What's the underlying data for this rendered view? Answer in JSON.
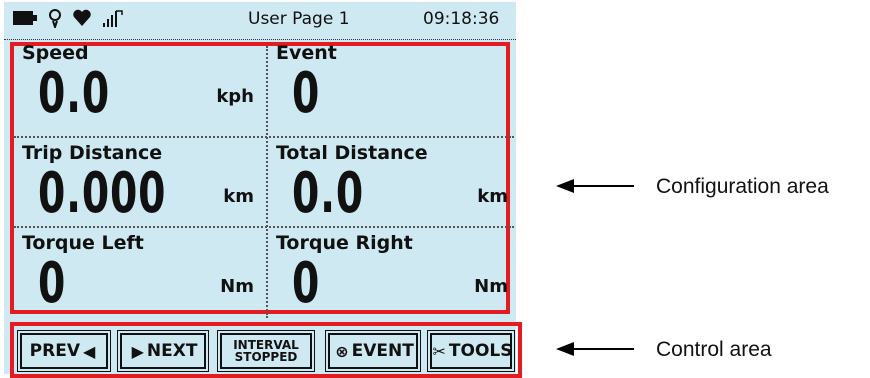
{
  "statusbar": {
    "icons": [
      "battery-icon",
      "location-icon",
      "heart-icon",
      "signal-icon"
    ],
    "title": "User Page 1",
    "time": "09:18:36"
  },
  "fields": [
    {
      "label": "Speed",
      "value": "0.0",
      "unit": "kph"
    },
    {
      "label": "Event",
      "value": "0",
      "unit": ""
    },
    {
      "label": "Trip Distance",
      "value": "0.000",
      "unit": "km"
    },
    {
      "label": "Total Distance",
      "value": "0.0",
      "unit": "km"
    },
    {
      "label": "Torque Left",
      "value": "0",
      "unit": "Nm"
    },
    {
      "label": "Torque Right",
      "value": "0",
      "unit": "Nm"
    }
  ],
  "controls": {
    "prev": "PREV",
    "next": "NEXT",
    "interval_line1": "INTERVAL",
    "interval_line2": "STOPPED",
    "event": "EVENT",
    "tools": "TOOLS"
  },
  "annotations": {
    "configuration": "Configuration area",
    "control": "Control area"
  },
  "colors": {
    "highlight": "#e31b23",
    "screen": "#cfe9f2"
  }
}
